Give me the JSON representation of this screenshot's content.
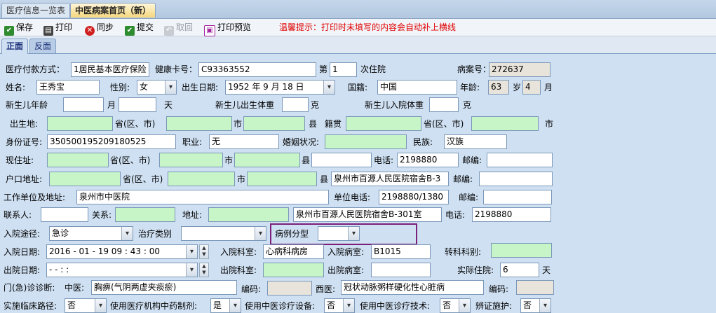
{
  "tabs": [
    {
      "label": "医疗信息一览表",
      "active": false
    },
    {
      "label": "中医病案首页（新）",
      "active": true
    }
  ],
  "toolbar": {
    "save": "保存",
    "print": "打印",
    "sync": "同步",
    "submit": "提交",
    "revoke": "取回",
    "preview": "打印预览",
    "tip": "温馨提示：打印时未填写的内容会自动补上横线"
  },
  "subtabs": [
    {
      "label": "正面",
      "active": true
    },
    {
      "label": "反面",
      "active": false
    }
  ],
  "row1": {
    "pay_label": "医疗付款方式：",
    "pay_value": "1居民基本医疗保险",
    "card_label": "健康卡号：",
    "card_value": "C93363552",
    "nth_label": "第",
    "nth_value": "1",
    "nth_suffix": "次住院",
    "case_label": "病案号：",
    "case_value": "272637"
  },
  "row2": {
    "name_label": "姓名:",
    "name_value": "王秀宝",
    "sex_label": "性别:",
    "sex_value": "女",
    "birth_label": "出生日期:",
    "birth_value": "1952 年 9 月 18 日",
    "nation_label": "国籍:",
    "nation_value": "中国",
    "age_label": "年龄:",
    "age_value": "63",
    "age_unit": "岁",
    "month_value": "4",
    "month_unit": "月"
  },
  "row3": {
    "baby_age_label": "新生儿年龄",
    "month_unit": "月",
    "day_unit": "天",
    "birth_weight_label": "新生儿出生体重",
    "gram1": "克",
    "admit_weight_label": "新生儿入院体重",
    "gram2": "克"
  },
  "row4": {
    "birthplace_label": "出生地:",
    "prov": "省(区、市)",
    "city": "市",
    "county": "县",
    "native_label": "籍贯",
    "prov2": "省(区、市)",
    "city2": "市"
  },
  "row5": {
    "id_label": "身份证号:",
    "id_value": "350500195209180525",
    "job_label": "职业:",
    "job_value": "无",
    "marital_label": "婚姻状况:",
    "ethnic_label": "民族:",
    "ethnic_value": "汉族"
  },
  "row6": {
    "addr_label": "现住址:",
    "prov": "省(区、市)",
    "city": "市",
    "county": "县",
    "phone_label": "电话:",
    "phone_value": "2198880",
    "zip_label": "邮编:"
  },
  "row7": {
    "hukou_label": "户口地址:",
    "prov": "省(区、市)",
    "city": "市",
    "county": "县",
    "detail_value": "泉州市百源人民医院宿舍B-3",
    "zip_label": "邮编:"
  },
  "row8": {
    "work_label": "工作单位及地址:",
    "work_value": "泉州市中医院",
    "work_phone_label": "单位电话:",
    "work_phone_value": "2198880/1380",
    "zip_label": "邮编:"
  },
  "row9": {
    "contact_label": "联系人:",
    "relation_label": "关系:",
    "address_label": "地址:",
    "address_value": "泉州市百源人民医院宿舍B-301室",
    "phone_label": "电话:",
    "phone_value": "2198880"
  },
  "row10": {
    "route_label": "入院途径:",
    "route_value": "急诊",
    "treat_label": "治疗类别",
    "case_type_label": "病例分型"
  },
  "row11": {
    "admit_date_label": "入院日期:",
    "admit_date_value": "2016 - 01 - 19   09 : 43 : 00",
    "admit_dept_label": "入院科室:",
    "admit_dept_value": "心病科病房",
    "admit_ward_label": "入院病室:",
    "admit_ward_value": "B1015",
    "transfer_label": "转科科别:"
  },
  "row12": {
    "discharge_date_label": "出院日期:",
    "discharge_date_value": "  -   -       :    :",
    "discharge_dept_label": "出院科室:",
    "discharge_ward_label": "出院病室:",
    "stay_label": "实际住院:",
    "stay_value": "6",
    "stay_unit": "天"
  },
  "row13": {
    "diag_label": "门(急)诊诊断:",
    "tcm_label": "中医:",
    "tcm_value": "胸痹(气阴两虚夹痰瘀)",
    "code_label": "编码:",
    "west_label": "西医:",
    "west_value": "冠状动脉粥样硬化性心脏病",
    "code2_label": "编码:"
  },
  "row14": {
    "path_label": "实施临床路径:",
    "path_value": "否",
    "herb_label": "使用医疗机构中药制剂:",
    "herb_value": "是",
    "device_label": "使用中医诊疗设备:",
    "device_value": "否",
    "tech_label": "使用中医诊疗技术:",
    "tech_value": "否",
    "dialectic_label": "辨证施护:",
    "dialectic_value": "否"
  }
}
